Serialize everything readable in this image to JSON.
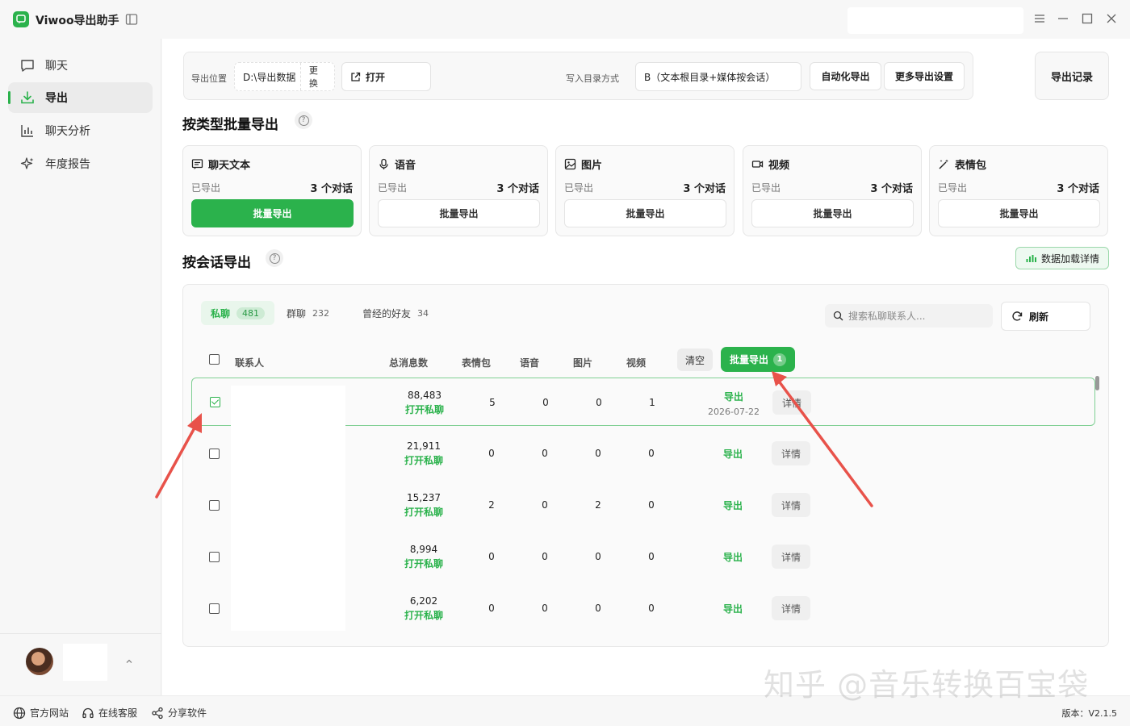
{
  "app": {
    "title": "Viwoo导出助手"
  },
  "sidebar": {
    "items": [
      {
        "label": "聊天",
        "icon": "chat-icon"
      },
      {
        "label": "导出",
        "icon": "download-icon",
        "active": true
      },
      {
        "label": "聊天分析",
        "icon": "bar-chart-icon"
      },
      {
        "label": "年度报告",
        "icon": "sparkle-icon"
      }
    ]
  },
  "toolbar": {
    "path_label": "导出位置",
    "path_value": "D:\\导出数据",
    "change_label": "更换",
    "open_label": "打开",
    "dir_mode_label": "写入目录方式",
    "dir_mode_value": "B（文本根目录+媒体按会话）",
    "auto_export_label": "自动化导出",
    "more_settings_label": "更多导出设置",
    "export_log_label": "导出记录"
  },
  "by_type": {
    "title": "按类型批量导出",
    "cards": [
      {
        "name": "聊天文本",
        "icon": "message-text-icon",
        "exported_label": "已导出",
        "count": "3 个对话",
        "button": "批量导出",
        "primary": true
      },
      {
        "name": "语音",
        "icon": "mic-icon",
        "exported_label": "已导出",
        "count": "3 个对话",
        "button": "批量导出"
      },
      {
        "name": "图片",
        "icon": "image-icon",
        "exported_label": "已导出",
        "count": "3 个对话",
        "button": "批量导出"
      },
      {
        "name": "视频",
        "icon": "video-icon",
        "exported_label": "已导出",
        "count": "3 个对话",
        "button": "批量导出"
      },
      {
        "name": "表情包",
        "icon": "magic-wand-icon",
        "exported_label": "已导出",
        "count": "3 个对话",
        "button": "批量导出"
      }
    ]
  },
  "by_session": {
    "title": "按会话导出",
    "data_detail_label": "数据加载详情",
    "tabs": [
      {
        "label": "私聊",
        "count": "481",
        "active": true
      },
      {
        "label": "群聊",
        "count": "232"
      },
      {
        "label": "曾经的好友",
        "count": "34"
      }
    ],
    "search_placeholder": "搜索私聊联系人...",
    "refresh_label": "刷新",
    "columns": [
      "联系人",
      "总消息数",
      "表情包",
      "语音",
      "图片",
      "视频"
    ],
    "clear_label": "清空",
    "batch_export_label": "批量导出",
    "batch_count": "1",
    "rows": [
      {
        "total": "88,483",
        "open": "打开私聊",
        "sticker": "5",
        "voice": "0",
        "image": "0",
        "video": "1",
        "export": "导出",
        "date": "2026-07-22",
        "detail": "详情",
        "checked": true
      },
      {
        "total": "21,911",
        "open": "打开私聊",
        "sticker": "0",
        "voice": "0",
        "image": "0",
        "video": "0",
        "export": "导出",
        "date": "",
        "detail": "详情"
      },
      {
        "total": "15,237",
        "open": "打开私聊",
        "sticker": "2",
        "voice": "0",
        "image": "2",
        "video": "0",
        "export": "导出",
        "date": "",
        "detail": "详情"
      },
      {
        "total": "8,994",
        "open": "打开私聊",
        "sticker": "0",
        "voice": "0",
        "image": "0",
        "video": "0",
        "export": "导出",
        "date": "",
        "detail": "详情"
      },
      {
        "total": "6,202",
        "open": "打开私聊",
        "sticker": "0",
        "voice": "0",
        "image": "0",
        "video": "0",
        "export": "导出",
        "date": "",
        "detail": "详情"
      }
    ]
  },
  "footer": {
    "links": [
      {
        "label": "官方网站",
        "icon": "globe-icon"
      },
      {
        "label": "在线客服",
        "icon": "headset-icon"
      },
      {
        "label": "分享软件",
        "icon": "share-icon"
      }
    ],
    "version": "版本：V2.1.5"
  },
  "watermark": "知乎 @音乐转换百宝袋",
  "colors": {
    "accent": "#2bb24c",
    "annotation_arrow": "#e8524a"
  }
}
